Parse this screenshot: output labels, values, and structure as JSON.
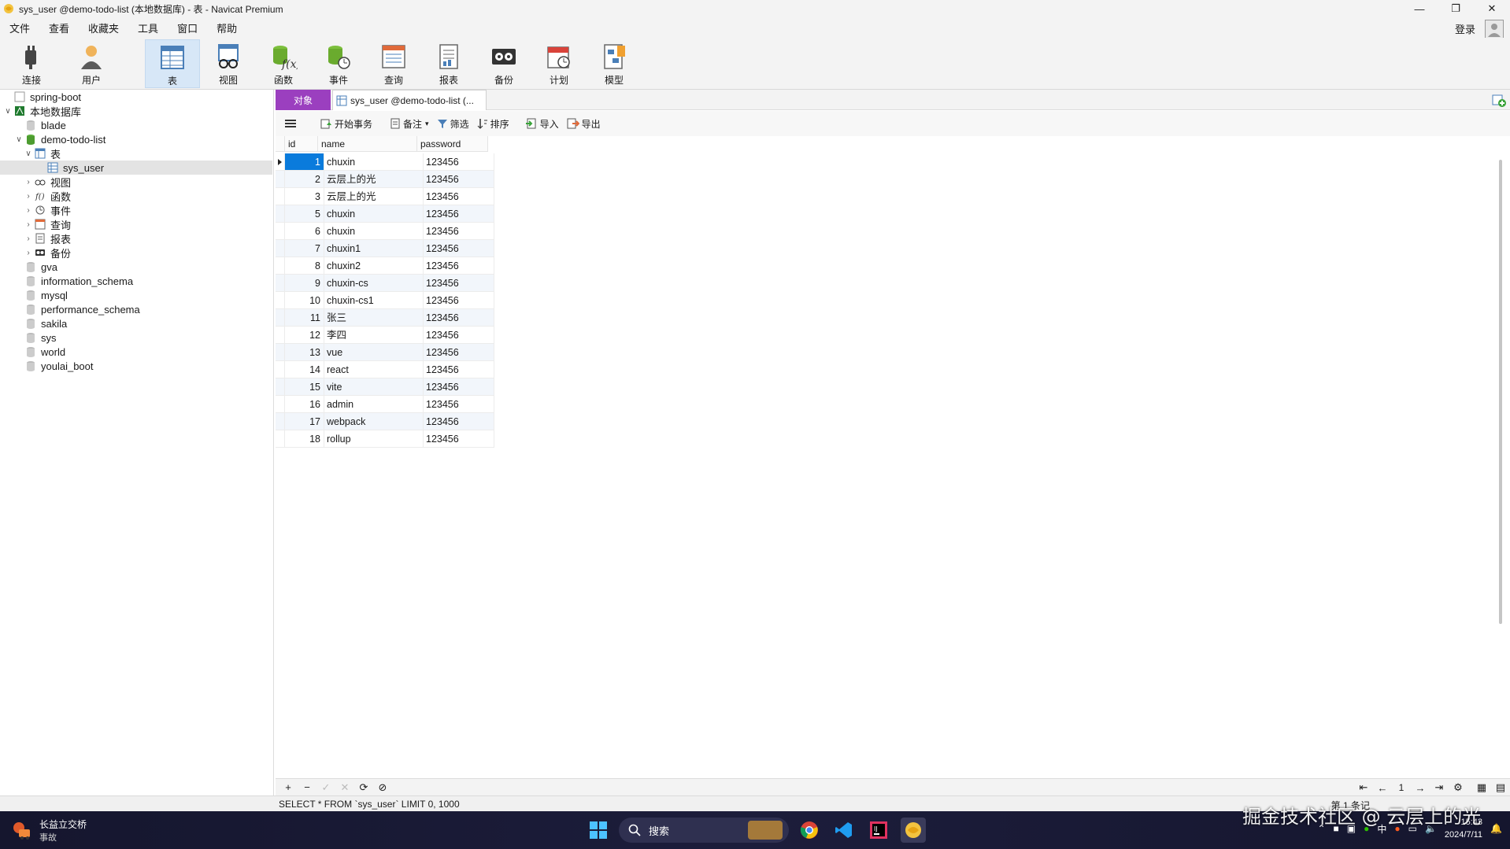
{
  "window": {
    "title": "sys_user @demo-todo-list (本地数据库) - 表 - Navicat Premium"
  },
  "menu": [
    "文件",
    "查看",
    "收藏夹",
    "工具",
    "窗口",
    "帮助"
  ],
  "login_label": "登录",
  "toolbar": {
    "connect": "连接",
    "user": "用户",
    "table": "表",
    "view": "视图",
    "function": "函数",
    "event": "事件",
    "query": "查询",
    "report": "报表",
    "backup": "备份",
    "schedule": "计划",
    "model": "模型"
  },
  "tree": {
    "spring_boot": "spring-boot",
    "local_db": "本地数据库",
    "blade": "blade",
    "demo_todo_list": "demo-todo-list",
    "tables": "表",
    "sys_user": "sys_user",
    "views": "视图",
    "functions": "函数",
    "events": "事件",
    "queries": "查询",
    "reports": "报表",
    "backups": "备份",
    "dbs": [
      "gva",
      "information_schema",
      "mysql",
      "performance_schema",
      "sakila",
      "sys",
      "world",
      "youlai_boot"
    ]
  },
  "tabs": {
    "objects": "对象",
    "doc": "sys_user @demo-todo-list (..."
  },
  "data_toolbar": {
    "begin_tx": "开始事务",
    "memo": "备注",
    "filter": "筛选",
    "sort": "排序",
    "import": "导入",
    "export": "导出"
  },
  "grid": {
    "columns": [
      "id",
      "name",
      "password"
    ],
    "rows": [
      [
        "1",
        "chuxin",
        "123456"
      ],
      [
        "2",
        "云层上的光",
        "123456"
      ],
      [
        "3",
        "云层上的光",
        "123456"
      ],
      [
        "5",
        "chuxin",
        "123456"
      ],
      [
        "6",
        "chuxin",
        "123456"
      ],
      [
        "7",
        "chuxin1",
        "123456"
      ],
      [
        "8",
        "chuxin2",
        "123456"
      ],
      [
        "9",
        "chuxin-cs",
        "123456"
      ],
      [
        "10",
        "chuxin-cs1",
        "123456"
      ],
      [
        "11",
        "张三",
        "123456"
      ],
      [
        "12",
        "李四",
        "123456"
      ],
      [
        "13",
        "vue",
        "123456"
      ],
      [
        "14",
        "react",
        "123456"
      ],
      [
        "15",
        "vite",
        "123456"
      ],
      [
        "16",
        "admin",
        "123456"
      ],
      [
        "17",
        "webpack",
        "123456"
      ],
      [
        "18",
        "rollup",
        "123456"
      ]
    ]
  },
  "nav": {
    "page": "1"
  },
  "status": {
    "sql": "SELECT * FROM `sys_user` LIMIT 0, 1000",
    "record": "第 1 条记"
  },
  "taskbar": {
    "weather_line1": "长益立交桥",
    "weather_line2": "事故",
    "search": "搜索",
    "ime": "中",
    "time": "15:43",
    "date": "2024/7/11"
  },
  "watermark": "掘金技术社区 @ 云层上的光"
}
